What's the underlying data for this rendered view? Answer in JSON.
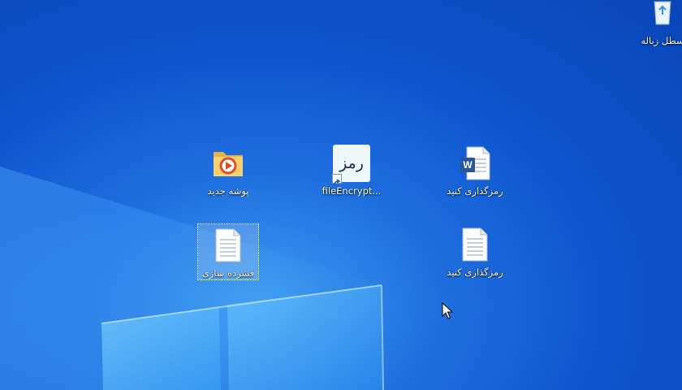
{
  "desktop": {
    "background": "#0e55cf",
    "accent": "#3f9cf0",
    "icons": [
      {
        "id": "new-folder",
        "label": "پوشه جدید",
        "icon": "folder-icon"
      },
      {
        "id": "file-encrypt",
        "label": "fileEncrypt...",
        "icon": "ramz-app-icon",
        "shortcut": true
      },
      {
        "id": "word-doc",
        "label": "رمزگذاری کنید",
        "icon": "word-document-icon"
      },
      {
        "id": "compress-doc",
        "label": "فشرده سازی",
        "icon": "text-document-icon",
        "selected": true
      },
      {
        "id": "text-doc",
        "label": "رمزگذاری کنید",
        "icon": "text-document-icon"
      }
    ],
    "recycle_bin": {
      "label": "سطل زباله",
      "icon": "recycle-bin-icon"
    },
    "app_icon_text": "رمز"
  }
}
